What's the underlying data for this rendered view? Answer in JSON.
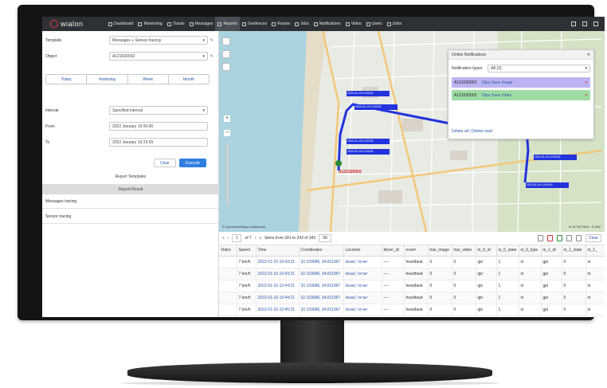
{
  "nav": {
    "logo": "wialon",
    "items": [
      {
        "label": "Dashboard",
        "icon": "chart-icon"
      },
      {
        "label": "Monitoring",
        "icon": "monitor-icon"
      },
      {
        "label": "Tracks",
        "icon": "flag-icon"
      },
      {
        "label": "Messages",
        "icon": "envelope-icon"
      },
      {
        "label": "Reports",
        "icon": "document-icon",
        "active": true
      },
      {
        "label": "Geofences",
        "icon": "geofence-icon"
      },
      {
        "label": "Routes",
        "icon": "route-icon"
      },
      {
        "label": "Jobs",
        "icon": "jobs-icon"
      },
      {
        "label": "Notifications",
        "icon": "bell-icon"
      },
      {
        "label": "Video",
        "icon": "video-icon"
      },
      {
        "label": "Users",
        "icon": "user-icon"
      },
      {
        "label": "Units",
        "icon": "car-icon"
      }
    ]
  },
  "report": {
    "template_label": "Template",
    "template_value": "Messages + Sensor tracing",
    "object_label": "Object",
    "object_value": "A121020002",
    "tabs": [
      "Today",
      "Yesterday",
      "Week",
      "Month"
    ],
    "interval_label": "Interval",
    "interval_value": "Specified interval",
    "from_label": "From",
    "from_value": "2022 January 19 00:00",
    "to_label": "To",
    "to_value": "2022 January 19 23:59",
    "clear_label": "Clear",
    "execute_label": "Execute",
    "templates_label": "Report Templates",
    "result_label": "Report Result",
    "sections": [
      "Messages tracing",
      "Sensor tracing"
    ]
  },
  "map": {
    "unit_label": "A121020002",
    "track_labels": [
      "2022-01-19 12:53:00",
      "2022-01-19 12:53:00",
      "2022-01-19 12:53:00",
      "2022-01-19 12:53:00",
      "2022-01-19 12:53:00",
      "2022-01-19 12:54:00"
    ],
    "attribution": "© OpenStreetMap contributors",
    "coordinates": "N 32°06.7906' : E 034°"
  },
  "notifications": {
    "title": "Online Notifications",
    "types_label": "Notification types:",
    "types_value": "All (2)",
    "items": [
      {
        "unit": "A121020002",
        "event": "Clips Save Image",
        "color": "#bcb4f2"
      },
      {
        "unit": "A121020002",
        "event": "Clips Save Video",
        "color": "#9fdca5"
      }
    ],
    "footer": "Delete all / Delete read"
  },
  "pager": {
    "page": "1",
    "of_pages": "of 7",
    "items_text": "Items from 301 to 343 of 343",
    "per_page": "50",
    "clear_label": "Clear"
  },
  "table": {
    "columns": [
      "Video",
      "Speed",
      "Time",
      "Coordinates",
      "Location",
      "driver_id",
      "event",
      "has_image",
      "has_video",
      "io_0_id",
      "io_0_state",
      "io_0_type",
      "io_1_id",
      "io_1_state",
      "io_1_"
    ],
    "rows": [
      [
        "",
        "7 km/h",
        "2022-01-10 10:43:21",
        "32.103686, 34.811967",
        "Israel, ישראל",
        "----",
        "heartbeat",
        "0",
        "0",
        "ign",
        "1",
        "in",
        "gpi",
        "0",
        "in"
      ],
      [
        "",
        "7 km/h",
        "2022-01-10 10:43:21",
        "32.103686, 34.811967",
        "Israel, ישראל",
        "----",
        "heartbeat",
        "0",
        "0",
        "ign",
        "1",
        "in",
        "gpi",
        "0",
        "in"
      ],
      [
        "",
        "7 km/h",
        "2022-01-10 10:44:21",
        "32.103686, 34.811967",
        "Israel, ישראל",
        "----",
        "heartbeat",
        "0",
        "0",
        "ign",
        "1",
        "in",
        "gpi",
        "0",
        "in"
      ],
      [
        "",
        "7 km/h",
        "2022-01-10 10:44:21",
        "32.103686, 34.811967",
        "Israel, ישראל",
        "----",
        "heartbeat",
        "0",
        "0",
        "ign",
        "1",
        "in",
        "gpi",
        "0",
        "in"
      ],
      [
        "",
        "7 km/h",
        "2022-01-10 10:45:21",
        "32.103686, 34.811967",
        "Israel, ישראל",
        "----",
        "heartbeat",
        "0",
        "0",
        "ign",
        "1",
        "in",
        "gpi",
        "0",
        "in"
      ]
    ]
  },
  "colors": {
    "accent": "#2f7fe0",
    "track": "#2233dd",
    "nav_bg": "#2d3136"
  }
}
